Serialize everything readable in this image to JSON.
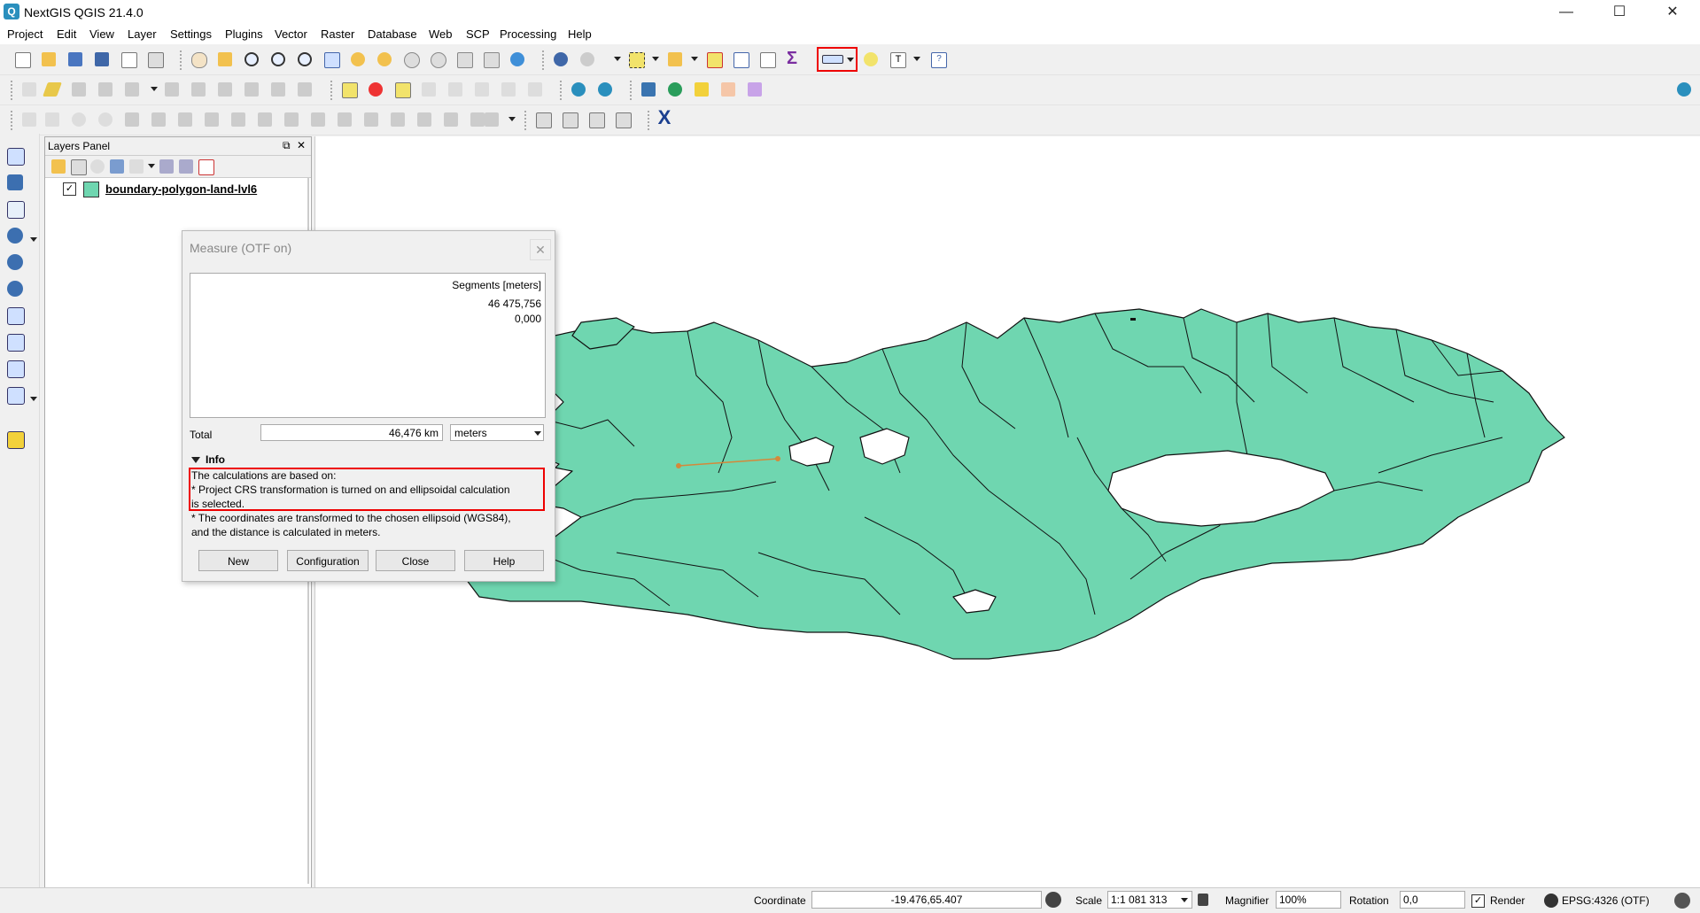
{
  "window": {
    "title": "NextGIS QGIS 21.4.0",
    "app_icon_glyph": "Q"
  },
  "window_controls": {
    "minimize": "—",
    "maximize": "☐",
    "close": "✕"
  },
  "menu": [
    "Project",
    "Edit",
    "View",
    "Layer",
    "Settings",
    "Plugins",
    "Vector",
    "Raster",
    "Database",
    "Web",
    "SCP",
    "Processing",
    "Help"
  ],
  "layers_panel": {
    "title": "Layers Panel",
    "float_icon": "⧉",
    "close_icon": "✕",
    "layers": [
      {
        "name": "boundary-polygon-land-lvl6",
        "checked": "✓",
        "color": "#6fd6b0"
      }
    ]
  },
  "measure_dialog": {
    "title": "Measure (OTF on)",
    "close_glyph": "✕",
    "segments_header": "Segments [meters]",
    "segments": [
      "46 475,756",
      "0,000"
    ],
    "total_label": "Total",
    "total_value": "46,476 km",
    "units": "meters",
    "info_label": "Info",
    "info_lines": [
      "The calculations are based on:",
      "* Project CRS transformation is turned on and ellipsoidal calculation",
      "is selected.",
      "* The coordinates are transformed to the chosen ellipsoid (WGS84),",
      "and the distance is calculated in meters."
    ],
    "buttons": {
      "new": "New",
      "configuration": "Configuration",
      "close": "Close",
      "help": "Help"
    }
  },
  "status_bar": {
    "coordinate_label": "Coordinate",
    "coordinate_value": "-19.476,65.407",
    "scale_label": "Scale",
    "scale_value": "1:1 081 313",
    "magnifier_label": "Magnifier",
    "magnifier_value": "100%",
    "rotation_label": "Rotation",
    "rotation_value": "0,0",
    "render_label": "Render",
    "render_checked": "✓",
    "crs_label": "EPSG:4326 (OTF)"
  },
  "colors": {
    "land_fill": "#6fd6b0",
    "highlight": "#e00000",
    "measure_line": "#d4893a"
  }
}
